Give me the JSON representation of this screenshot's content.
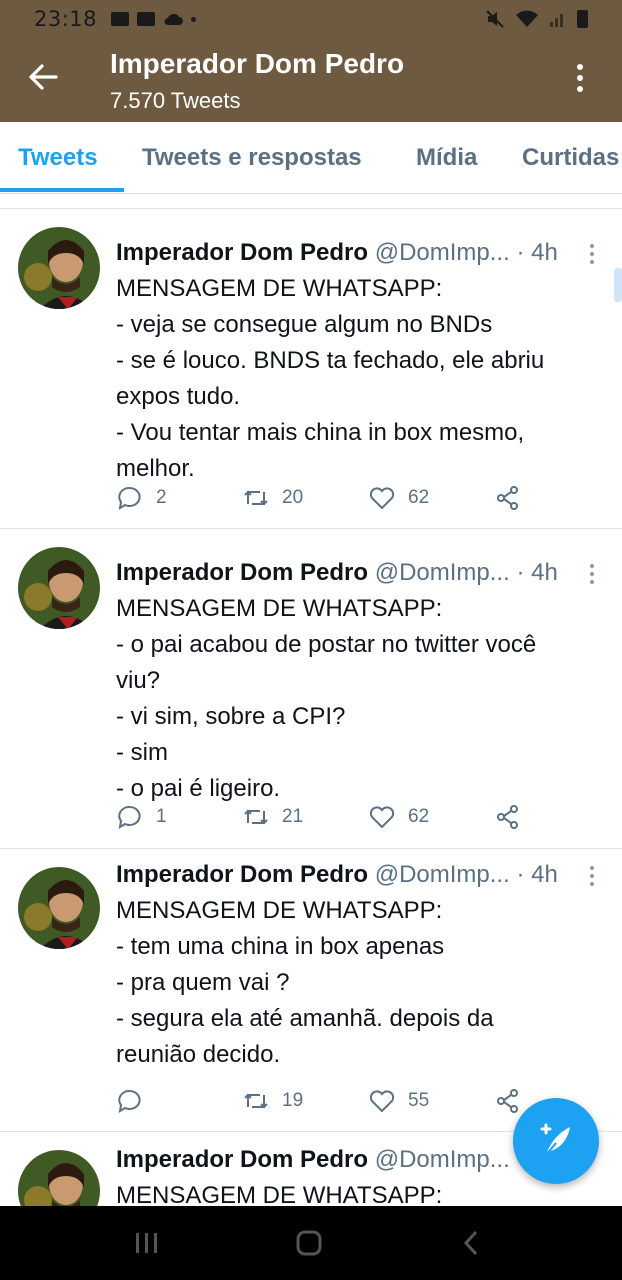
{
  "status_bar": {
    "time": "23:18",
    "icons": [
      "gallery-icon",
      "youtube-icon",
      "cloud-icon",
      "dot-icon",
      "mute-icon",
      "wifi-icon",
      "signal-icon",
      "battery-icon"
    ]
  },
  "header": {
    "title": "Imperador Dom Pedro",
    "subtitle": "7.570 Tweets",
    "background": "#6d5a41"
  },
  "tabs": [
    {
      "label": "Tweets",
      "active": true
    },
    {
      "label": "Tweets e respostas",
      "active": false
    },
    {
      "label": "Mídia",
      "active": false
    },
    {
      "label": "Curtidas",
      "active": false
    }
  ],
  "accent_color": "#1da1f2",
  "tweets": [
    {
      "name": "Imperador Dom Pedro",
      "handle": "@DomImp...",
      "dot": "·",
      "time": "4h",
      "lines": [
        "MENSAGEM DE WHATSAPP:",
        "- veja se consegue algum no BNDs",
        "- se é louco. BNDS ta fechado, ele abriu",
        "expos tudo.",
        "- Vou tentar mais china in box mesmo,",
        "melhor."
      ],
      "replies": "2",
      "retweets": "20",
      "likes": "62"
    },
    {
      "name": "Imperador Dom Pedro",
      "handle": "@DomImp...",
      "dot": "·",
      "time": "4h",
      "lines": [
        "MENSAGEM DE WHATSAPP:",
        "- o pai acabou de postar no twitter você",
        "viu?",
        "- vi sim, sobre a CPI?",
        "- sim",
        "- o pai é ligeiro."
      ],
      "replies": "1",
      "retweets": "21",
      "likes": "62"
    },
    {
      "name": "Imperador Dom Pedro",
      "handle": "@DomImp...",
      "dot": "·",
      "time": "4h",
      "lines": [
        "MENSAGEM DE WHATSAPP:",
        "- tem uma china in box apenas",
        "- pra quem vai ?",
        "- segura ela até amanhã. depois da",
        "reunião decido."
      ],
      "replies": "",
      "retweets": "19",
      "likes": "55"
    },
    {
      "name": "Imperador Dom Pedro",
      "handle": "@DomImp...",
      "dot": "",
      "time": "",
      "lines": [
        "MENSAGEM DE WHATSAPP:"
      ],
      "replies": "",
      "retweets": "",
      "likes": ""
    }
  ],
  "fab": {
    "icon": "compose-tweet-icon"
  },
  "nav_bar": {
    "icons": [
      "recent-apps-icon",
      "home-icon",
      "back-icon"
    ]
  }
}
